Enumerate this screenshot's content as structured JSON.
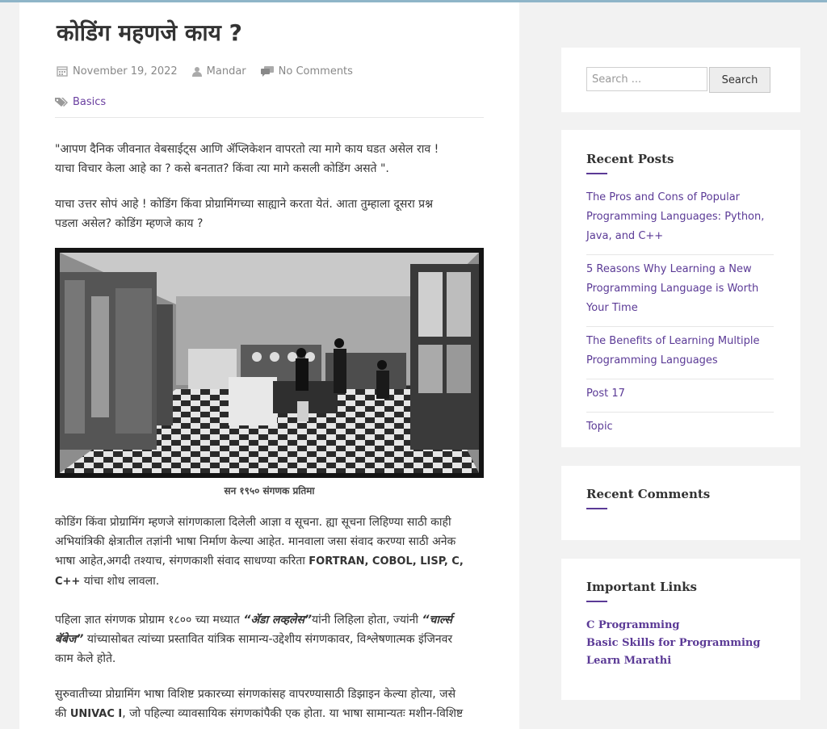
{
  "article": {
    "title": "कोडिंग महणजे काय ?",
    "date": "November 19, 2022",
    "author": "Mandar",
    "comments": "No Comments",
    "category": "Basics",
    "p1_line1": "\"आपण दैनिक जीवनात वेबसाईट्स आणि ॲप्लिकेशन वापरतो त्या मागे काय घडत असेल राव !",
    "p1_line2": "याचा विचार केला आहे का ? कसे बनतात? किंवा त्या मागे कसली कोडिंग असते \".",
    "p2_line1": "याचा उत्तर सोपं आहे ! कोडिंग किंवा प्रोग्रामिंगच्या साह्याने करता येतं. आता तुम्हाला दूसरा प्रश्न",
    "p2_line2": "पडला असेल? कोडिंग म्हणजे काय ?",
    "image_caption": "सन १९५० संगणक प्रतिमा",
    "p3_line1": "कोडिंग किंवा प्रोग्रामिंग म्हणजे सांगणकाला दिलेली आज्ञा व सूचना. ह्या सूचना लिहिण्या साठी काही",
    "p3_line2": "अभियांत्रिकी क्षेत्रातील तज्ञांनी भाषा निर्माण केल्या आहेत. मानवाला जसा संवाद करण्या साठी अनेक",
    "p3_line3": "भाषा आहेत,अगदी तश्याच, संगणकाशी संवाद साधण्या करिता",
    "p3_langs": "FORTRAN, COBOL, LISP, C,",
    "p3_langs2": "C++",
    "p3_line4": "यांचा शोध लावला.",
    "p4_a": "पहिला ज्ञात संगणक प्रोग्राम १८०० च्या मध्यात",
    "p4_ada": "“ॲडा लव्हलेस”",
    "p4_b": "यांनी लिहिला होता, ज्यांनी",
    "p4_charles": "“चार्ल्स",
    "p4_charles2": "बॅबेज”",
    "p4_c": "यांच्यासोबत त्यांच्या प्रस्तावित यांत्रिक सामान्य-उद्देशीय संगणकावर, विश्लेषणात्मक इंजिनवर",
    "p4_line3": "काम केले होते.",
    "p5_line1": "सुरुवातीच्या प्रोग्रामिंग भाषा विशिष्ट प्रकारच्या संगणकांसह वापरण्यासाठी डिझाइन केल्या होत्या, जसे",
    "p5_a": "की",
    "p5_univac": "UNIVAC I",
    "p5_b": ", जो पहिल्या व्यावसायिक संगणकांपैकी एक होता. या भाषा सामान्यतः मशीन-विशिष्ट"
  },
  "sidebar": {
    "search": {
      "placeholder": "Search ...",
      "button": "Search"
    },
    "recent_posts": {
      "title": "Recent Posts",
      "items": [
        "The Pros and Cons of Popular Programming Languages: Python, Java, and C++",
        "5 Reasons Why Learning a New Programming Language is Worth Your Time",
        "The Benefits of Learning Multiple Programming Languages",
        "Post 17",
        "Topic"
      ]
    },
    "recent_comments": {
      "title": "Recent Comments"
    },
    "important_links": {
      "title": "Important Links",
      "items": [
        "C Programming",
        "Basic Skills for Programming",
        "Learn Marathi"
      ]
    }
  }
}
